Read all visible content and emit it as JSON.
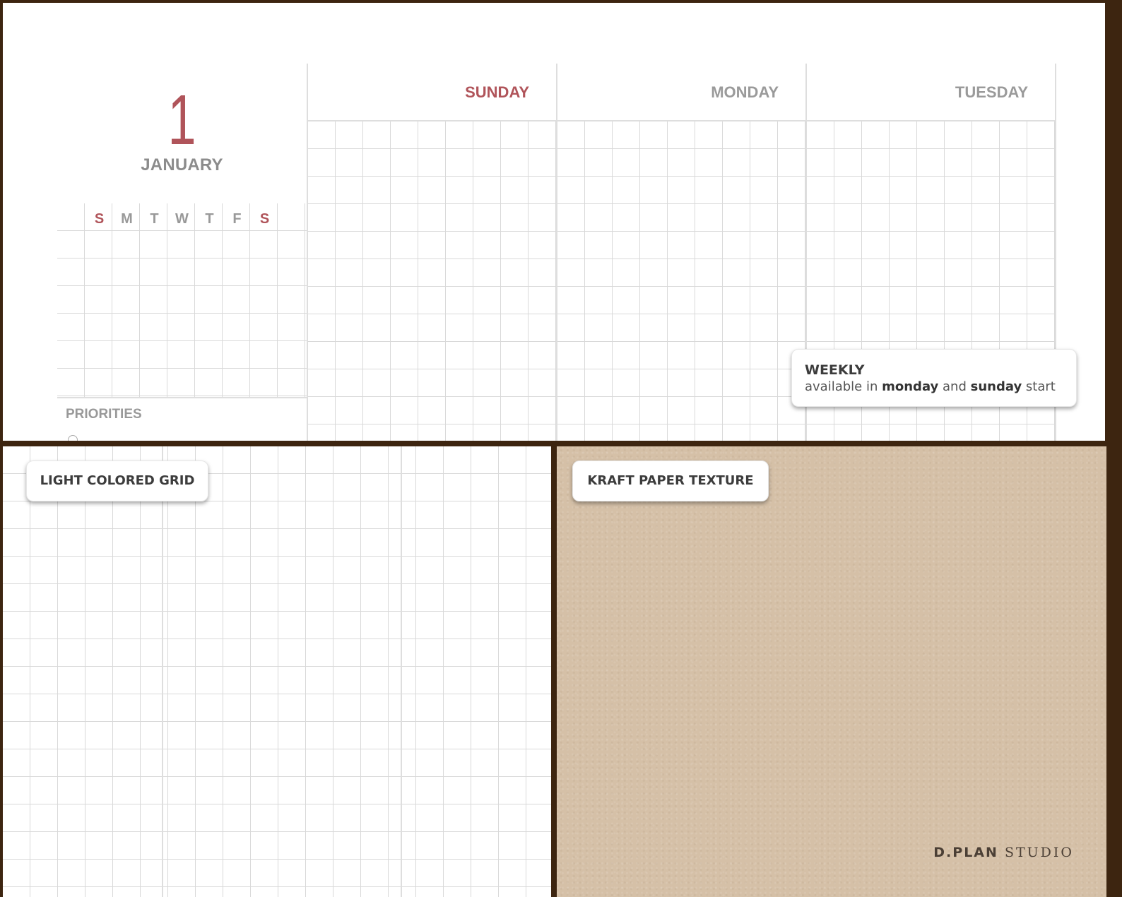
{
  "planner": {
    "day_number": "1",
    "month": "JANUARY",
    "mini_calendar_weekdays": [
      "S",
      "M",
      "T",
      "W",
      "T",
      "F",
      "S"
    ],
    "priorities_label": "PRIORITIES",
    "days": [
      "SUNDAY",
      "MONDAY",
      "TUESDAY"
    ]
  },
  "callouts": {
    "weekly_title": "WEEKLY",
    "weekly_text_1": "available in",
    "weekly_bold_1": "monday",
    "weekly_text_2": "and",
    "weekly_bold_2": "sunday",
    "weekly_text_3": "start",
    "grid_label": "LIGHT COLORED GRID",
    "kraft_label": "KRAFT PAPER TEXTURE"
  },
  "brand": {
    "bold": "D.PLAN",
    "light": "STUDIO"
  },
  "colors": {
    "frame": "#3d2510",
    "accent_red": "#b0545a",
    "label_gray": "#9a9a9a",
    "kraft": "#d5c0a7"
  }
}
